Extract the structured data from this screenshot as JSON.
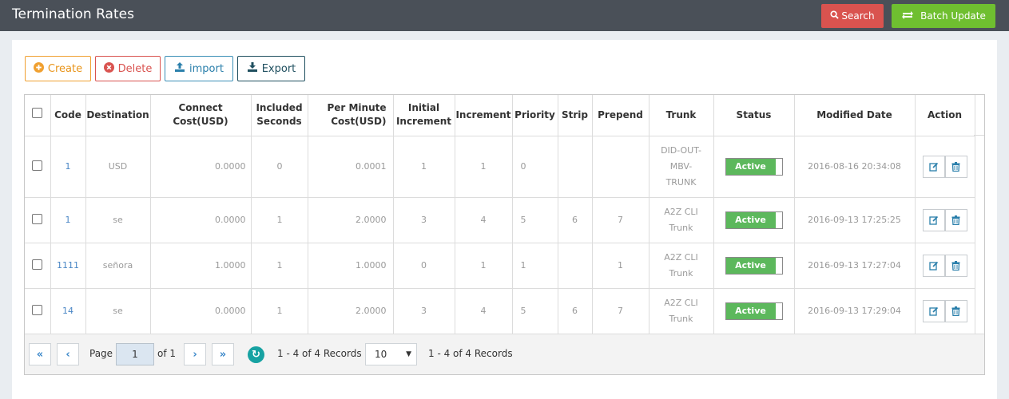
{
  "header": {
    "title": "Termination Rates",
    "search_label": "Search",
    "batch_update_label": "Batch Update"
  },
  "toolbar": {
    "create_label": "Create",
    "delete_label": "Delete",
    "import_label": "import",
    "export_label": "Export"
  },
  "table": {
    "columns": [
      "Code",
      "Destination",
      "Connect Cost(USD)",
      "Included Seconds",
      "Per Minute Cost(USD)",
      "Initial Increment",
      "Increment",
      "Priority",
      "Strip",
      "Prepend",
      "Trunk",
      "Status",
      "Modified Date",
      "Action"
    ],
    "column_lines": {
      "included": [
        "Included",
        "Seconds"
      ],
      "per_minute": [
        "Per Minute",
        "Cost(USD)"
      ],
      "initial": [
        "Initial",
        "Increment"
      ]
    },
    "rows": [
      {
        "code": "1",
        "destination": "USD",
        "connect_cost": "0.0000",
        "included_seconds": "0",
        "per_minute_cost": "0.0001",
        "initial_increment": "1",
        "increment": "1",
        "priority": "0",
        "strip": "",
        "prepend": "",
        "trunk": [
          "DID-OUT-",
          "MBV-",
          "TRUNK"
        ],
        "status": "Active",
        "modified": "2016-08-16 20:34:08"
      },
      {
        "code": "1",
        "destination": "se",
        "connect_cost": "0.0000",
        "included_seconds": "1",
        "per_minute_cost": "2.0000",
        "initial_increment": "3",
        "increment": "4",
        "priority": "5",
        "strip": "6",
        "prepend": "7",
        "trunk": [
          "A2Z CLI",
          "Trunk"
        ],
        "status": "Active",
        "modified": "2016-09-13 17:25:25"
      },
      {
        "code": "1111",
        "destination": "señora",
        "connect_cost": "1.0000",
        "included_seconds": "1",
        "per_minute_cost": "1.0000",
        "initial_increment": "0",
        "increment": "1",
        "priority": "1",
        "strip": "",
        "prepend": "1",
        "trunk": [
          "A2Z CLI",
          "Trunk"
        ],
        "status": "Active",
        "modified": "2016-09-13 17:27:04"
      },
      {
        "code": "14",
        "destination": "se",
        "connect_cost": "0.0000",
        "included_seconds": "1",
        "per_minute_cost": "2.0000",
        "initial_increment": "3",
        "increment": "4",
        "priority": "5",
        "strip": "6",
        "prepend": "7",
        "trunk": [
          "A2Z CLI",
          "Trunk"
        ],
        "status": "Active",
        "modified": "2016-09-13 17:29:04"
      }
    ]
  },
  "pager": {
    "page_label": "Page",
    "page_value": "1",
    "of_label": "of 1",
    "records_text": "1 - 4 of 4 Records",
    "page_size": "10",
    "records_text_2": "1 - 4 of 4 Records"
  },
  "icons": {
    "search": "search-icon",
    "batch": "refresh-arrows-icon",
    "create": "plus-circle-icon",
    "delete": "times-circle-icon",
    "import": "upload-icon",
    "export": "download-icon",
    "edit": "edit-icon",
    "trash": "trash-icon"
  },
  "colors": {
    "topbar": "#4a5058",
    "search": "#d9534f",
    "batch": "#6fbf30",
    "active": "#5cb85c",
    "link": "#4a86c5"
  }
}
